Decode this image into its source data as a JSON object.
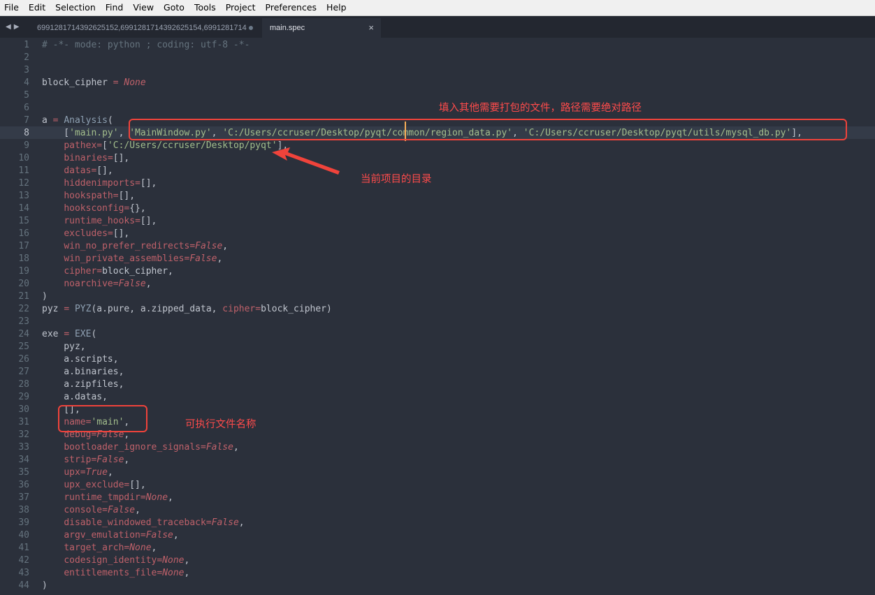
{
  "menu": [
    "File",
    "Edit",
    "Selection",
    "Find",
    "View",
    "Goto",
    "Tools",
    "Project",
    "Preferences",
    "Help"
  ],
  "tabs": {
    "nav_left": "◀",
    "nav_right": "▶",
    "tab1_label": "6991281714392625152,6991281714392625154,6991281714",
    "tab2_label": "main.spec",
    "close_glyph": "×"
  },
  "gutter": {
    "line_numbers": [
      "1",
      "2",
      "3",
      "4",
      "5",
      "6",
      "7",
      "8",
      "9",
      "10",
      "11",
      "12",
      "13",
      "14",
      "15",
      "16",
      "17",
      "18",
      "19",
      "20",
      "21",
      "22",
      "23",
      "24",
      "25",
      "26",
      "27",
      "28",
      "29",
      "30",
      "31",
      "32",
      "33",
      "34",
      "35",
      "36",
      "37",
      "38",
      "39",
      "40",
      "41",
      "42",
      "43",
      "44"
    ],
    "active_line": "8"
  },
  "code_lines": [
    [
      {
        "t": "# -*- mode: python ; coding: utf-8 -*-",
        "c": "c"
      }
    ],
    [],
    [],
    [
      {
        "t": "block_cipher "
      },
      {
        "t": "=",
        "c": "o"
      },
      {
        "t": " "
      },
      {
        "t": "None",
        "c": "v"
      }
    ],
    [],
    [],
    [
      {
        "t": "a "
      },
      {
        "t": "=",
        "c": "o"
      },
      {
        "t": " "
      },
      {
        "t": "Analysis",
        "c": "f"
      },
      {
        "t": "("
      }
    ],
    [
      {
        "t": "    ["
      },
      {
        "t": "'main.py'",
        "c": "s"
      },
      {
        "t": ", "
      },
      {
        "t": "'MainWindow.py'",
        "c": "s"
      },
      {
        "t": ", "
      },
      {
        "t": "'C:/Users/ccruser/Desktop/pyqt/common/region_data.py'",
        "c": "s"
      },
      {
        "t": ", "
      },
      {
        "t": "'C:/Users/ccruser/Desktop/pyqt/utils/mysql_db.py'",
        "c": "s"
      },
      {
        "t": "],"
      }
    ],
    [
      {
        "t": "    "
      },
      {
        "t": "pathex",
        "c": "k"
      },
      {
        "t": "=",
        "c": "o"
      },
      {
        "t": "["
      },
      {
        "t": "'C:/Users/ccruser/Desktop/pyqt'",
        "c": "s"
      },
      {
        "t": "],"
      }
    ],
    [
      {
        "t": "    "
      },
      {
        "t": "binaries",
        "c": "k"
      },
      {
        "t": "=",
        "c": "o"
      },
      {
        "t": "[],"
      }
    ],
    [
      {
        "t": "    "
      },
      {
        "t": "datas",
        "c": "k"
      },
      {
        "t": "=",
        "c": "o"
      },
      {
        "t": "[],"
      }
    ],
    [
      {
        "t": "    "
      },
      {
        "t": "hiddenimports",
        "c": "k"
      },
      {
        "t": "=",
        "c": "o"
      },
      {
        "t": "[],"
      }
    ],
    [
      {
        "t": "    "
      },
      {
        "t": "hookspath",
        "c": "k"
      },
      {
        "t": "=",
        "c": "o"
      },
      {
        "t": "[],"
      }
    ],
    [
      {
        "t": "    "
      },
      {
        "t": "hooksconfig",
        "c": "k"
      },
      {
        "t": "=",
        "c": "o"
      },
      {
        "t": "{},"
      }
    ],
    [
      {
        "t": "    "
      },
      {
        "t": "runtime_hooks",
        "c": "k"
      },
      {
        "t": "=",
        "c": "o"
      },
      {
        "t": "[],"
      }
    ],
    [
      {
        "t": "    "
      },
      {
        "t": "excludes",
        "c": "k"
      },
      {
        "t": "=",
        "c": "o"
      },
      {
        "t": "[],"
      }
    ],
    [
      {
        "t": "    "
      },
      {
        "t": "win_no_prefer_redirects",
        "c": "k"
      },
      {
        "t": "=",
        "c": "o"
      },
      {
        "t": "False",
        "c": "v"
      },
      {
        "t": ","
      }
    ],
    [
      {
        "t": "    "
      },
      {
        "t": "win_private_assemblies",
        "c": "k"
      },
      {
        "t": "=",
        "c": "o"
      },
      {
        "t": "False",
        "c": "v"
      },
      {
        "t": ","
      }
    ],
    [
      {
        "t": "    "
      },
      {
        "t": "cipher",
        "c": "k"
      },
      {
        "t": "=",
        "c": "o"
      },
      {
        "t": "block_cipher,"
      }
    ],
    [
      {
        "t": "    "
      },
      {
        "t": "noarchive",
        "c": "k"
      },
      {
        "t": "=",
        "c": "o"
      },
      {
        "t": "False",
        "c": "v"
      },
      {
        "t": ","
      }
    ],
    [
      {
        "t": ")"
      }
    ],
    [
      {
        "t": "pyz "
      },
      {
        "t": "=",
        "c": "o"
      },
      {
        "t": " "
      },
      {
        "t": "PYZ",
        "c": "f"
      },
      {
        "t": "(a.pure, a.zipped_data, "
      },
      {
        "t": "cipher",
        "c": "k"
      },
      {
        "t": "=",
        "c": "o"
      },
      {
        "t": "block_cipher)"
      }
    ],
    [],
    [
      {
        "t": "exe "
      },
      {
        "t": "=",
        "c": "o"
      },
      {
        "t": " "
      },
      {
        "t": "EXE",
        "c": "f"
      },
      {
        "t": "("
      }
    ],
    [
      {
        "t": "    pyz,"
      }
    ],
    [
      {
        "t": "    a.scripts,"
      }
    ],
    [
      {
        "t": "    a.binaries,"
      }
    ],
    [
      {
        "t": "    a.zipfiles,"
      }
    ],
    [
      {
        "t": "    a.datas,"
      }
    ],
    [
      {
        "t": "    [],"
      }
    ],
    [
      {
        "t": "    "
      },
      {
        "t": "name",
        "c": "k"
      },
      {
        "t": "=",
        "c": "o"
      },
      {
        "t": "'main'",
        "c": "s"
      },
      {
        "t": ","
      }
    ],
    [
      {
        "t": "    "
      },
      {
        "t": "debug",
        "c": "k"
      },
      {
        "t": "=",
        "c": "o"
      },
      {
        "t": "False",
        "c": "v"
      },
      {
        "t": ","
      }
    ],
    [
      {
        "t": "    "
      },
      {
        "t": "bootloader_ignore_signals",
        "c": "k"
      },
      {
        "t": "=",
        "c": "o"
      },
      {
        "t": "False",
        "c": "v"
      },
      {
        "t": ","
      }
    ],
    [
      {
        "t": "    "
      },
      {
        "t": "strip",
        "c": "k"
      },
      {
        "t": "=",
        "c": "o"
      },
      {
        "t": "False",
        "c": "v"
      },
      {
        "t": ","
      }
    ],
    [
      {
        "t": "    "
      },
      {
        "t": "upx",
        "c": "k"
      },
      {
        "t": "=",
        "c": "o"
      },
      {
        "t": "True",
        "c": "v"
      },
      {
        "t": ","
      }
    ],
    [
      {
        "t": "    "
      },
      {
        "t": "upx_exclude",
        "c": "k"
      },
      {
        "t": "=",
        "c": "o"
      },
      {
        "t": "[],"
      }
    ],
    [
      {
        "t": "    "
      },
      {
        "t": "runtime_tmpdir",
        "c": "k"
      },
      {
        "t": "=",
        "c": "o"
      },
      {
        "t": "None",
        "c": "v"
      },
      {
        "t": ","
      }
    ],
    [
      {
        "t": "    "
      },
      {
        "t": "console",
        "c": "k"
      },
      {
        "t": "=",
        "c": "o"
      },
      {
        "t": "False",
        "c": "v"
      },
      {
        "t": ","
      }
    ],
    [
      {
        "t": "    "
      },
      {
        "t": "disable_windowed_traceback",
        "c": "k"
      },
      {
        "t": "=",
        "c": "o"
      },
      {
        "t": "False",
        "c": "v"
      },
      {
        "t": ","
      }
    ],
    [
      {
        "t": "    "
      },
      {
        "t": "argv_emulation",
        "c": "k"
      },
      {
        "t": "=",
        "c": "o"
      },
      {
        "t": "False",
        "c": "v"
      },
      {
        "t": ","
      }
    ],
    [
      {
        "t": "    "
      },
      {
        "t": "target_arch",
        "c": "k"
      },
      {
        "t": "=",
        "c": "o"
      },
      {
        "t": "None",
        "c": "v"
      },
      {
        "t": ","
      }
    ],
    [
      {
        "t": "    "
      },
      {
        "t": "codesign_identity",
        "c": "k"
      },
      {
        "t": "=",
        "c": "o"
      },
      {
        "t": "None",
        "c": "v"
      },
      {
        "t": ","
      }
    ],
    [
      {
        "t": "    "
      },
      {
        "t": "entitlements_file",
        "c": "k"
      },
      {
        "t": "=",
        "c": "o"
      },
      {
        "t": "None",
        "c": "v"
      },
      {
        "t": ","
      }
    ],
    [
      {
        "t": ")"
      }
    ]
  ],
  "annotations": {
    "datas_note": "填入其他需要打包的文件，路径需要绝对路径",
    "pathex_note": "当前项目的目录",
    "name_note": "可执行文件名称",
    "color": "#f0433b"
  },
  "colors": {
    "editor_bg": "#2b303b",
    "keyword": "#bf616a",
    "string": "#a3be8c",
    "function": "#8fa1b3",
    "comment": "#65737e",
    "cursor": "#f9ae58"
  }
}
